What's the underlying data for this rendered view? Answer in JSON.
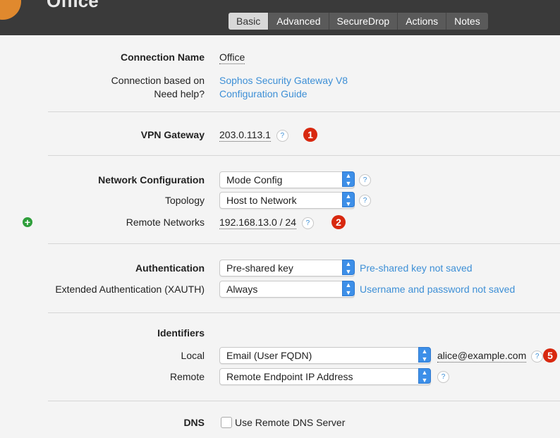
{
  "window": {
    "title": "Office"
  },
  "tabs": [
    {
      "label": "Basic",
      "active": true
    },
    {
      "label": "Advanced"
    },
    {
      "label": "SecureDrop"
    },
    {
      "label": "Actions"
    },
    {
      "label": "Notes"
    }
  ],
  "connection": {
    "name_label": "Connection Name",
    "name_value": "Office",
    "based_on_label": "Connection based on",
    "based_on_value": "Sophos Security Gateway V8",
    "help_label": "Need help?",
    "help_value": "Configuration Guide"
  },
  "vpn": {
    "label": "VPN Gateway",
    "value": "203.0.113.1",
    "badge": "1"
  },
  "network": {
    "config_label": "Network Configuration",
    "config_value": "Mode Config",
    "topology_label": "Topology",
    "topology_value": "Host to Network",
    "remote_label": "Remote Networks",
    "remote_value": "192.168.13.0 / 24",
    "badge": "2"
  },
  "auth": {
    "label": "Authentication",
    "value": "Pre-shared key",
    "note": "Pre-shared key not saved",
    "xauth_label": "Extended Authentication (XAUTH)",
    "xauth_value": "Always",
    "xauth_note": "Username and password not saved"
  },
  "identifiers": {
    "heading": "Identifiers",
    "local_label": "Local",
    "local_value": "Email (User FQDN)",
    "local_text": "alice@example.com",
    "remote_label": "Remote",
    "remote_value": "Remote Endpoint IP Address",
    "badge": "5"
  },
  "dns": {
    "label": "DNS",
    "checkbox_label": "Use Remote DNS Server"
  },
  "icons": {
    "help": "?",
    "plus": "+",
    "select_arrows": "▲▼"
  },
  "colors": {
    "accent": "#3d8fd6",
    "badge": "#d8280f",
    "plus": "#2e9e3a",
    "toolbar": "#3a3a3a"
  }
}
